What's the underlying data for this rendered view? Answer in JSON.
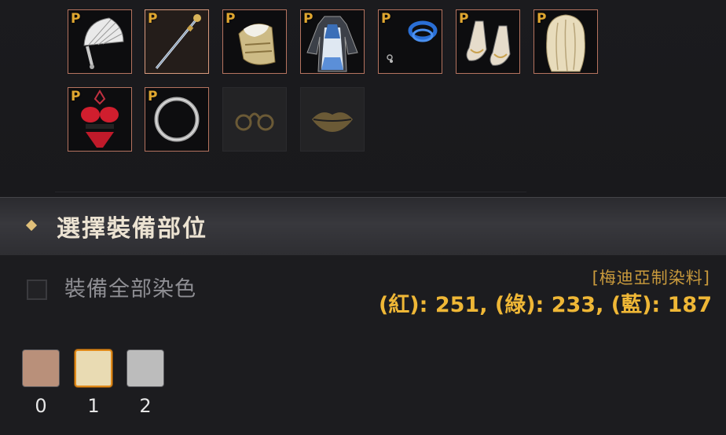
{
  "slots": [
    {
      "name": "fan",
      "badge": "P"
    },
    {
      "name": "staff",
      "badge": "P"
    },
    {
      "name": "headpiece",
      "badge": "P"
    },
    {
      "name": "outfit",
      "badge": "P"
    },
    {
      "name": "earring",
      "badge": "P"
    },
    {
      "name": "shoes",
      "badge": "P"
    },
    {
      "name": "hair",
      "badge": "P"
    },
    {
      "name": "underwear",
      "badge": "P"
    },
    {
      "name": "ring",
      "badge": "P"
    },
    {
      "name": "glasses-empty",
      "badge": ""
    },
    {
      "name": "lips-empty",
      "badge": ""
    }
  ],
  "header": {
    "title": "選擇裝備部位"
  },
  "dye_all": {
    "label": "裝備全部染色"
  },
  "dye": {
    "name": "[梅迪亞制染料]",
    "rgb_text": "(紅): 251, (綠): 233, (藍): 187"
  },
  "palette": [
    {
      "label": "0",
      "color": "#b9907a"
    },
    {
      "label": "1",
      "color": "#e9dbb3"
    },
    {
      "label": "2",
      "color": "#bcbcbc"
    }
  ],
  "colors": {
    "accent": "#efb736",
    "badge": "#e0a730",
    "slot_border": "#b5735f"
  }
}
